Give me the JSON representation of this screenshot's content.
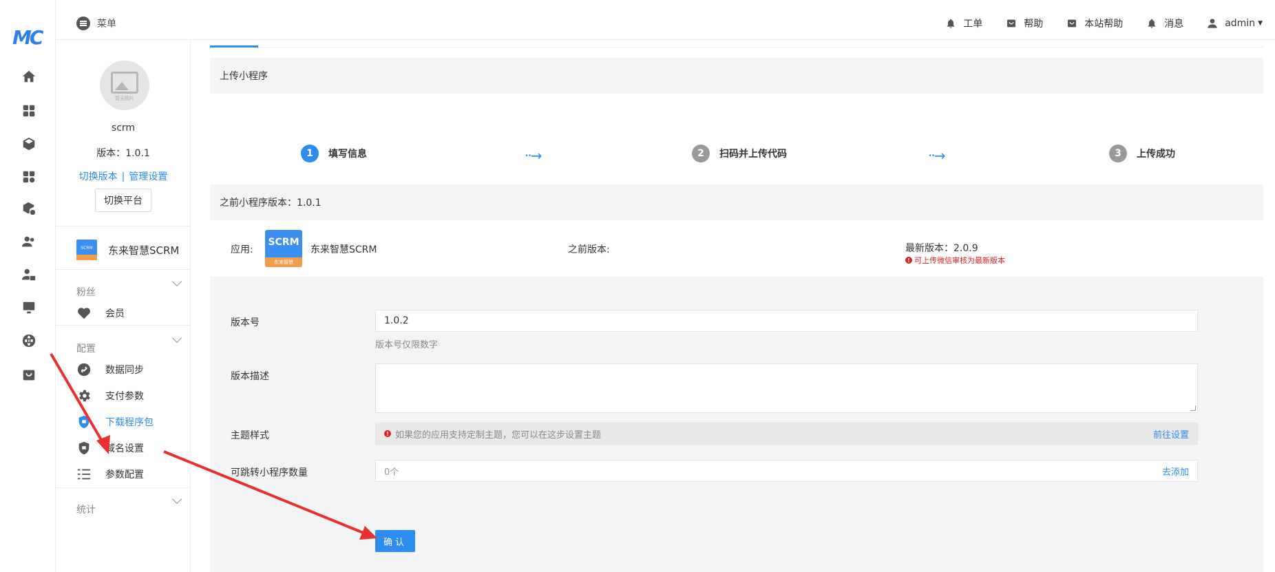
{
  "logo": {
    "text": "MC"
  },
  "rail": {
    "icons": [
      "home-icon",
      "grid-icon",
      "cube-icon",
      "apps-settings-icon",
      "cube-settings-icon",
      "users-icon",
      "user-lock-icon",
      "monitor-icon",
      "globe-icon",
      "store-icon"
    ]
  },
  "topbar": {
    "menu_label": "菜单",
    "actions": [
      {
        "label": "工单",
        "icon": "bell-icon"
      },
      {
        "label": "帮助",
        "icon": "store-icon"
      },
      {
        "label": "本站帮助",
        "icon": "store-icon"
      },
      {
        "label": "消息",
        "icon": "bell-icon"
      },
      {
        "label": "admin",
        "icon": "user-icon"
      }
    ]
  },
  "sidebar": {
    "avatar_caption": "暂无图片",
    "app_name": "scrm",
    "version": "版本：1.0.1",
    "switch_version": "切换版本",
    "separator": "|",
    "manage_settings": "管理设置",
    "switch_platform": "切换平台",
    "current_app": {
      "logo_text": "SCRM",
      "name": "东来智慧SCRM"
    },
    "groups": [
      {
        "title": "粉丝",
        "items": [
          {
            "label": "会员",
            "icon": "heart-icon"
          }
        ]
      },
      {
        "title": "配置",
        "items": [
          {
            "label": "数据同步",
            "icon": "link-icon"
          },
          {
            "label": "支付参数",
            "icon": "gear-icon"
          },
          {
            "label": "下载程序包",
            "icon": "shield-icon",
            "active": true
          },
          {
            "label": "域名设置",
            "icon": "shield-icon"
          },
          {
            "label": "参数配置",
            "icon": "list-icon"
          }
        ]
      },
      {
        "title": "统计",
        "items": []
      }
    ]
  },
  "main": {
    "section_title": "上传小程序",
    "steps": [
      {
        "num": "1",
        "label": "填写信息",
        "active": true
      },
      {
        "num": "2",
        "label": "扫码并上传代码",
        "active": false
      },
      {
        "num": "3",
        "label": "上传成功",
        "active": false
      }
    ],
    "step_arrow": "··→",
    "prev_version_header": "之前小程序版本：1.0.1",
    "info": {
      "app_label": "应用:",
      "app_tile_text": "SCRM",
      "app_tile_strip": "东来智慧",
      "app_name": "东来智慧SCRM",
      "prev_version_label": "之前版本:",
      "latest_version": "最新版本：2.0.9",
      "latest_warning": "可上传微信审核为最新版本"
    },
    "form": {
      "version_label": "版本号",
      "version_value": "1.0.2",
      "version_hint": "版本号仅限数字",
      "desc_label": "版本描述",
      "desc_value": "",
      "theme_label": "主题样式",
      "theme_notice": "如果您的应用支持定制主题，您可以在这步设置主题",
      "theme_link": "前往设置",
      "jump_label": "可跳转小程序数量",
      "jump_value": "0个",
      "jump_link": "去添加",
      "confirm": "确认"
    }
  },
  "colors": {
    "accent": "#2d8cf0",
    "annotation": "#e8312f",
    "panel_bg": "#f3f4f6"
  }
}
